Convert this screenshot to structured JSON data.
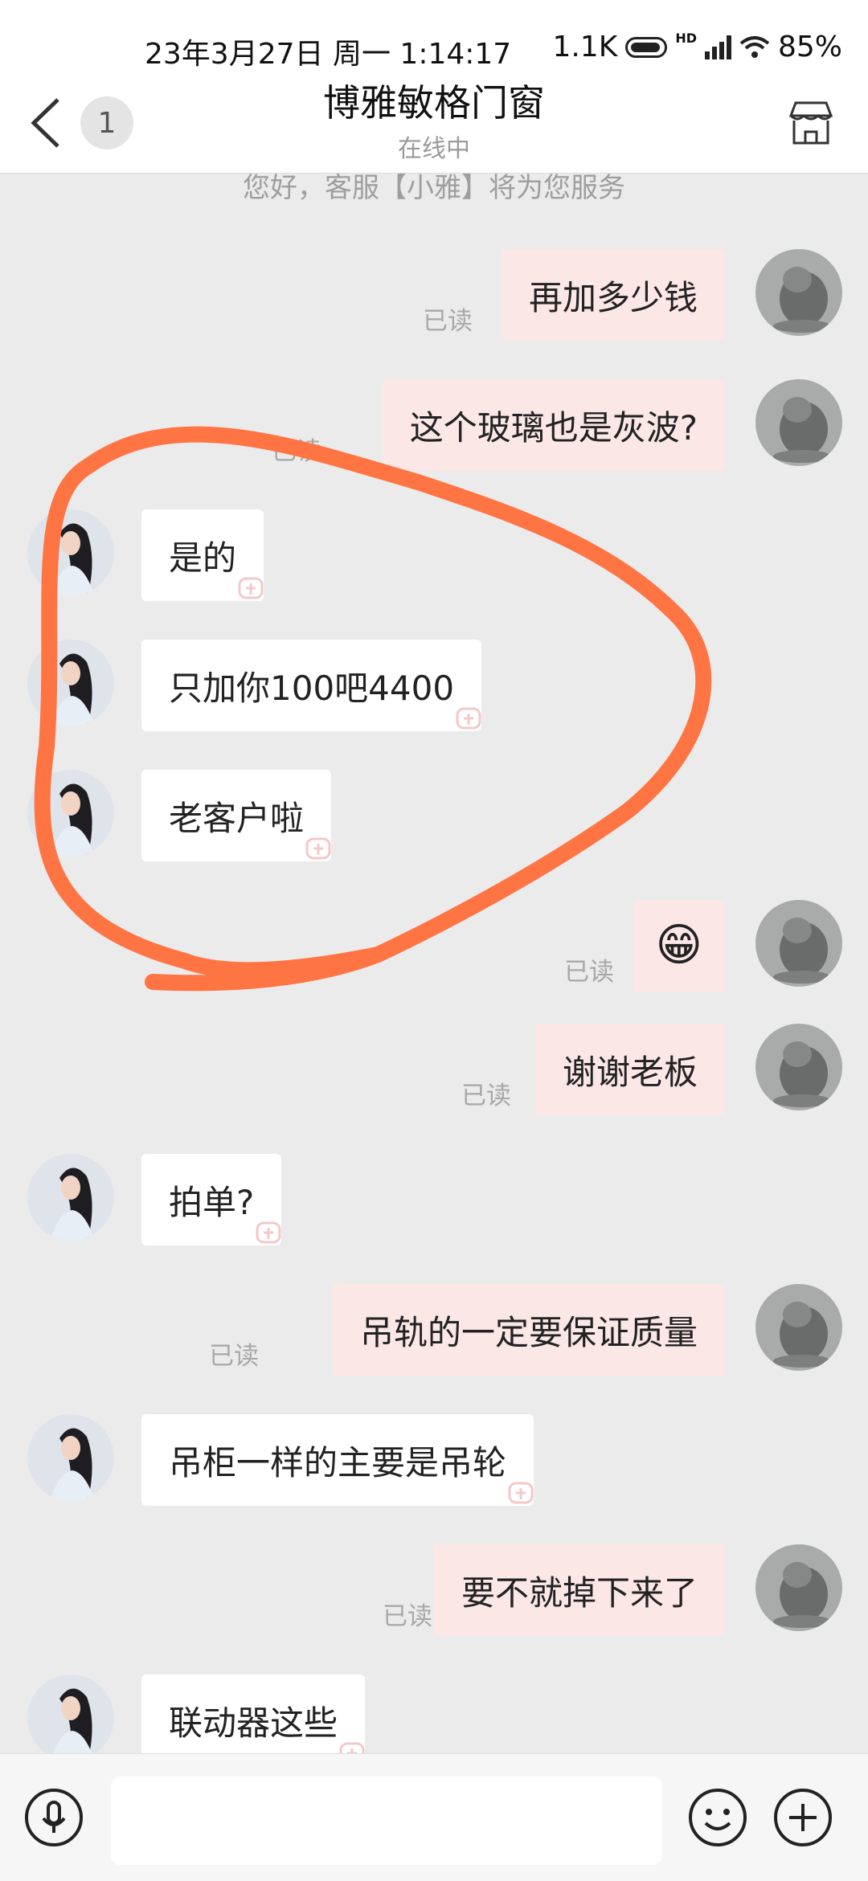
{
  "status_bar": {
    "datetime": "23年3月27日 周一 1:14:17",
    "speed": "1.1K",
    "network": "HD",
    "battery": "85%"
  },
  "header": {
    "back_badge": "1",
    "title": "博雅敏格门窗",
    "status": "在线中"
  },
  "chat": {
    "system_message": "您好，客服【小雅】将为您服务",
    "read_label": "已读",
    "messages": [
      {
        "from": "me",
        "text": "再加多少钱",
        "read": true
      },
      {
        "from": "me",
        "text": "这个玻璃也是灰波?",
        "read": true
      },
      {
        "from": "cs",
        "text": "是的"
      },
      {
        "from": "cs",
        "text": "只加你100吧4400"
      },
      {
        "from": "cs",
        "text": "老客户啦"
      },
      {
        "from": "me",
        "text": "😁",
        "read": true
      },
      {
        "from": "me",
        "text": "谢谢老板",
        "read": true
      },
      {
        "from": "cs",
        "text": "拍单?"
      },
      {
        "from": "me",
        "text": "吊轨的一定要保证质量",
        "read": true
      },
      {
        "from": "cs",
        "text": "吊柜一样的主要是吊轮"
      },
      {
        "from": "me",
        "text": "要不就掉下来了",
        "read": true
      },
      {
        "from": "cs",
        "text": "联动器这些"
      }
    ]
  },
  "input": {
    "placeholder": ""
  },
  "icons": {
    "back": "chevron-left-icon",
    "shop": "shop-icon",
    "voice": "microphone-icon",
    "emoji": "smiley-icon",
    "more": "plus-icon"
  },
  "colors": {
    "my_bubble": "#fbe7e6",
    "their_bubble": "#ffffff",
    "background": "#ebebeb",
    "annotation": "#ff7443"
  }
}
